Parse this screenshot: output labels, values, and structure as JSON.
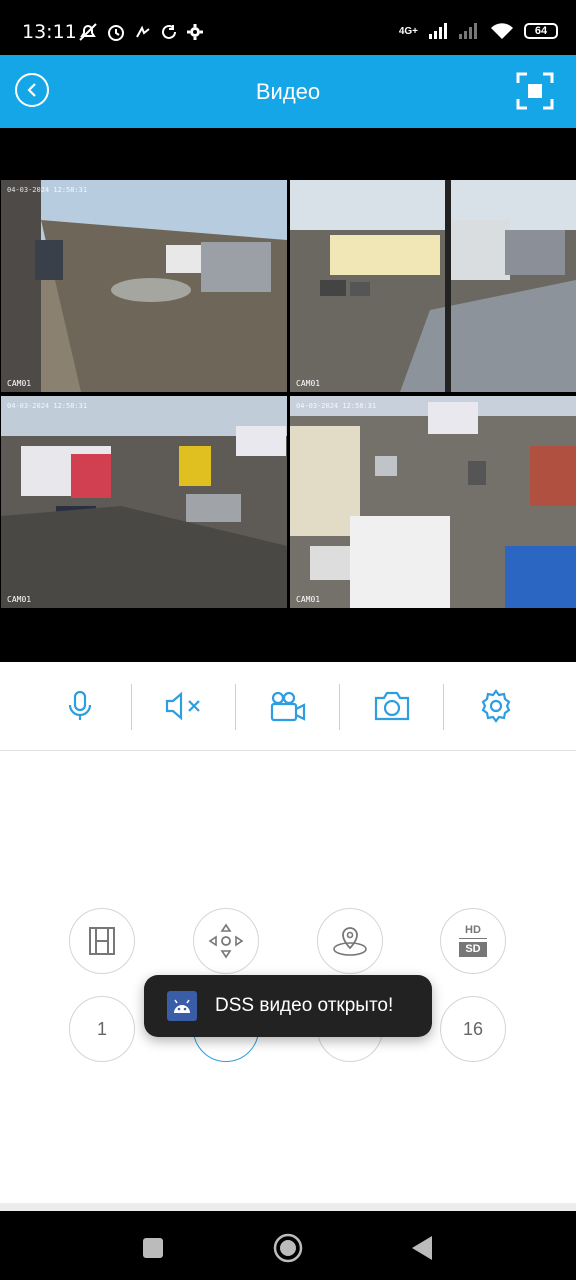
{
  "status_bar": {
    "time": "13:11",
    "network_label": "4G+",
    "battery": "64",
    "icons_left": [
      "mute-notifications-icon",
      "alarm-icon",
      "gesture-icon",
      "sync-icon",
      "settings-gear-icon"
    ],
    "icons_right": [
      "signal-4g-icon",
      "signal-off-icon",
      "wifi-icon",
      "battery-icon"
    ]
  },
  "header": {
    "title": "Видео",
    "back_icon": "chevron-left-icon",
    "fullscreen_icon": "fullscreen-icon",
    "background": "#14a6e6"
  },
  "video_grid": {
    "cameras": [
      {
        "label": "CAM01",
        "stamp": "04-03-2024 12:58:31"
      },
      {
        "label": "CAM01",
        "stamp": ""
      },
      {
        "label": "CAM01",
        "stamp": "04-03-2024 12:58:31"
      },
      {
        "label": "CAM01",
        "stamp": "04-03-2024 12:58:31"
      }
    ]
  },
  "controls": {
    "items": [
      {
        "name": "microphone-icon"
      },
      {
        "name": "speaker-mute-icon"
      },
      {
        "name": "video-record-icon"
      },
      {
        "name": "camera-snapshot-icon"
      },
      {
        "name": "settings-icon"
      }
    ],
    "accent": "#2d9ee0"
  },
  "panel": {
    "row1": [
      "film-icon",
      "ptz-direction-icon",
      "fisheye-icon",
      "hd-sd-icon"
    ],
    "hd_label": "HD",
    "sd_label": "SD",
    "row2": {
      "split_1": "1",
      "split_16": "16"
    }
  },
  "toast": {
    "text": "DSS видео открыто!",
    "icon": "android-icon"
  },
  "navbar": {
    "items": [
      "recents-square-icon",
      "home-circle-icon",
      "back-triangle-icon"
    ]
  }
}
